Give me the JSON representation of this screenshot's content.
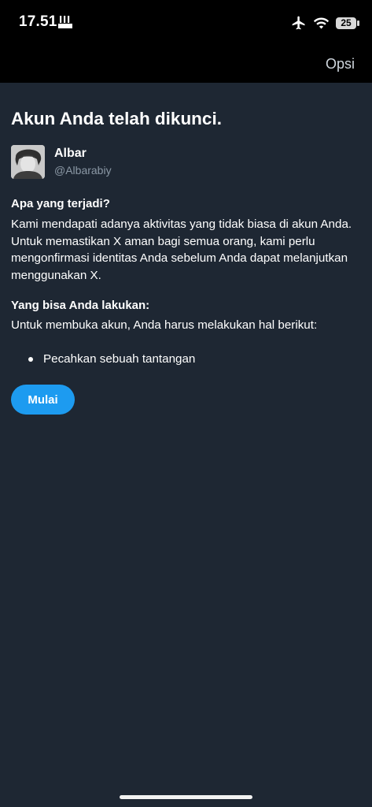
{
  "status_bar": {
    "time": "17.51",
    "carrier_icon": "signal-bars-icon",
    "airplane_icon": "airplane-icon",
    "wifi_icon": "wifi-icon",
    "battery_level": "25"
  },
  "header": {
    "options_label": "Opsi"
  },
  "main": {
    "title": "Akun Anda telah dikunci.",
    "user": {
      "name": "Albar",
      "handle": "@Albarabiy"
    },
    "what_happened": {
      "heading": "Apa yang terjadi?",
      "body": "Kami mendapati adanya aktivitas yang tidak biasa di akun Anda. Untuk memastikan X aman bagi semua orang, kami perlu mengonfirmasi identitas Anda sebelum Anda dapat melanjutkan menggunakan X."
    },
    "what_you_can_do": {
      "heading": "Yang bisa Anda lakukan:",
      "body": "Untuk membuka akun, Anda harus melakukan hal berikut:",
      "steps": [
        "Pecahkan sebuah tantangan"
      ]
    },
    "start_button": "Mulai"
  },
  "colors": {
    "background": "#1e2733",
    "topbar": "#000000",
    "accent": "#1d9bf0",
    "secondary_text": "#8b98a5"
  }
}
